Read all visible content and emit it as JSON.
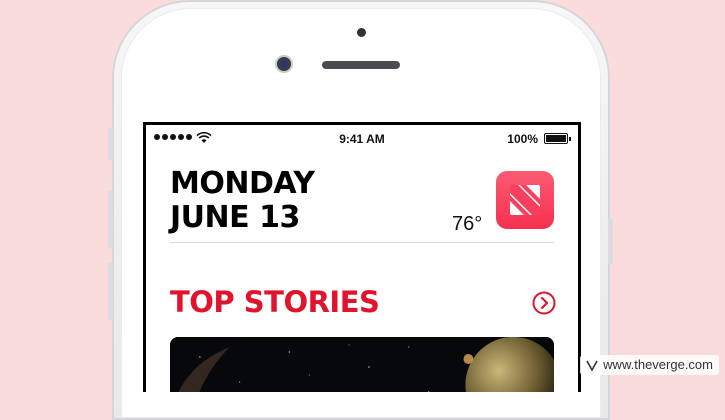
{
  "status_bar": {
    "time": "9:41 AM",
    "battery_percent": "100%",
    "signal_bars": 5
  },
  "header": {
    "day": "MONDAY",
    "date": "JUNE 13",
    "temperature": "76°",
    "app_icon": "apple-news-icon"
  },
  "section": {
    "title": "TOP STORIES",
    "more_icon": "chevron-right-circle-icon"
  },
  "colors": {
    "accent_red": "#e0152d",
    "background_pink": "#fbdcdc"
  },
  "watermark": {
    "text": "www.theverge.com",
    "icon": "verge-logo-icon"
  }
}
